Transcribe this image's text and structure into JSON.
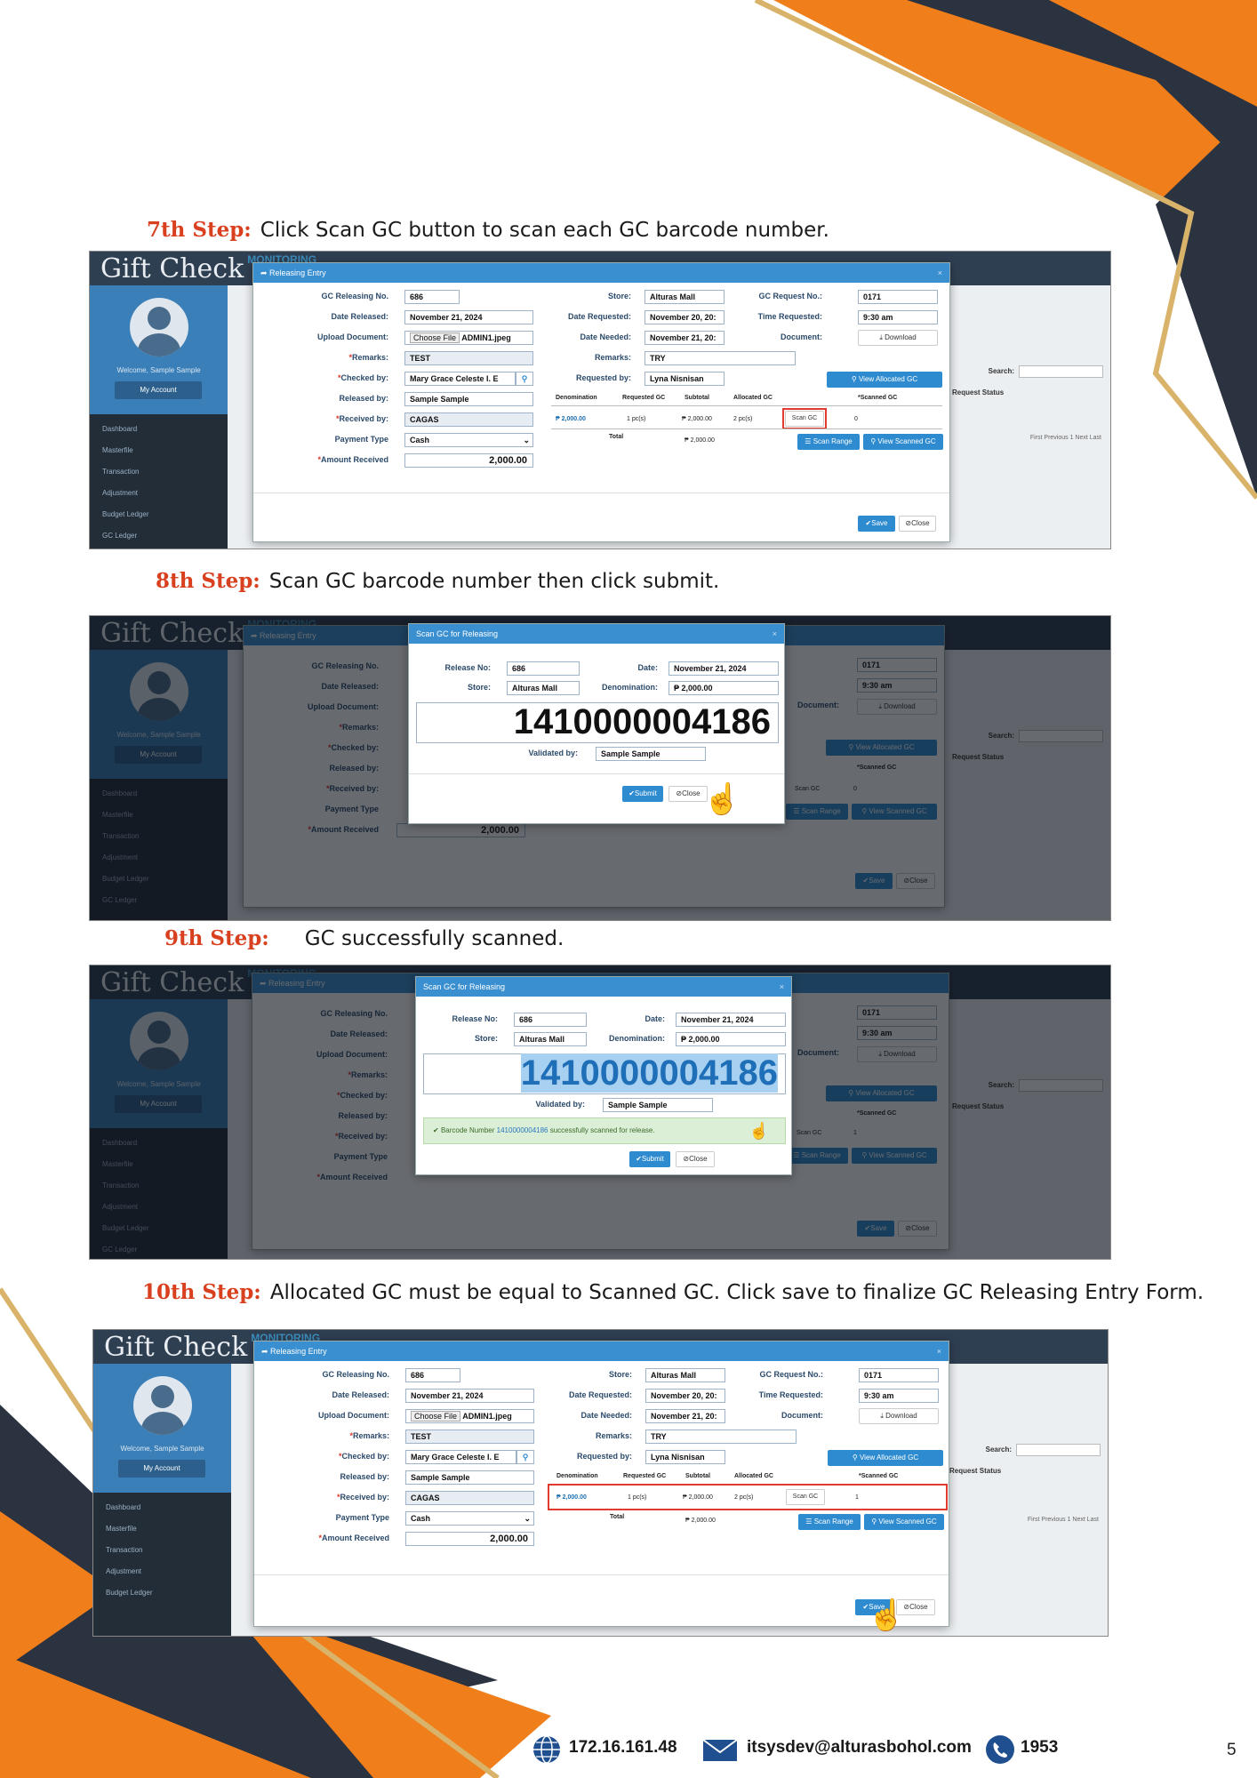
{
  "steps": {
    "s7": {
      "label": "7th Step:",
      "text": "Click Scan GC button to scan each GC barcode number."
    },
    "s8": {
      "label": "8th Step:",
      "text": "Scan GC barcode number then click submit."
    },
    "s9": {
      "label": "9th Step:",
      "text": "GC successfully scanned."
    },
    "s10": {
      "label": "10th Step:",
      "text": "Allocated GC must be equal to Scanned GC. Click save to finalize GC Releasing Entry Form."
    }
  },
  "app": {
    "brand": "Gift Check",
    "brand_sub": "MONITORING",
    "welcome": "Welcome, Sample Sample",
    "my_account": "My Account",
    "menu": [
      "Dashboard",
      "Masterfile",
      "Transaction",
      "Adjustment",
      "Budget Ledger",
      "GC Ledger"
    ],
    "search_label": "Search:",
    "request_status": "Request Status",
    "pager": "First   Previous   1   Next   Last"
  },
  "releasing": {
    "title": "Releasing Entry",
    "labels": {
      "gc_releasing_no": "GC Releasing No.",
      "date_released": "Date Released:",
      "upload_document": "Upload Document:",
      "remarks": "Remarks:",
      "checked_by": "Checked by:",
      "released_by": "Released by:",
      "received_by": "Received by:",
      "payment_type": "Payment Type",
      "amount_received": "Amount Received",
      "store": "Store:",
      "date_requested": "Date Requested:",
      "date_needed": "Date Needed:",
      "remarks2": "Remarks:",
      "requested_by": "Requested by:",
      "gc_request_no": "GC Request No.:",
      "time_requested": "Time Requested:",
      "document": "Document:"
    },
    "values": {
      "gc_releasing_no": "686",
      "date_released": "November 21, 2024",
      "choose_file": "Choose File",
      "file_name": "ADMIN1.jpeg",
      "remarks": "TEST",
      "checked_by": "Mary Grace Celeste I. E",
      "released_by": "Sample Sample",
      "received_by": "CAGAS",
      "payment_type": "Cash",
      "amount_received": "2,000.00",
      "store": "Alturas Mall",
      "date_requested": "November 20, 20:",
      "date_needed": "November 21, 20:",
      "remarks2": "TRY",
      "requested_by": "Lyna Nisnisan",
      "gc_request_no": "0171",
      "time_requested": "9:30 am",
      "download": "Download"
    },
    "table": {
      "headers": [
        "Denomination",
        "Requested GC",
        "Subtotal",
        "Allocated GC",
        "*Scanned GC"
      ],
      "row": {
        "denomination": "₱ 2,000.00",
        "requested": "1 pc(s)",
        "subtotal": "₱ 2,000.00",
        "allocated": "2 pc(s)",
        "scan_btn": "Scan GC"
      },
      "total_label": "Total",
      "total_value": "₱ 2,000.00",
      "scanned_before": "0",
      "scanned_after": "1"
    },
    "buttons": {
      "view_allocated": "View Allocated GC",
      "scan_range": "Scan Range",
      "view_scanned": "View Scanned GC",
      "save": "Save",
      "close": "Close"
    }
  },
  "scan_modal": {
    "title": "Scan GC for Releasing",
    "release_no_label": "Release No:",
    "release_no": "686",
    "date_label": "Date:",
    "date": "November 21, 2024",
    "store_label": "Store:",
    "store": "Alturas Mall",
    "denomination_label": "Denomination:",
    "denomination": "₱ 2,000.00",
    "barcode": "1410000004186",
    "validated_label": "Validated by:",
    "validated_by": "Sample Sample",
    "submit": "Submit",
    "close": "Close",
    "success_prefix": "Barcode Number",
    "success_number": "1410000004186",
    "success_suffix": "successfully scanned for release."
  },
  "footer": {
    "ip": "172.16.161.48",
    "email": "itsysdev@alturasbohol.com",
    "phone": "1953",
    "page": "5"
  },
  "colors": {
    "orange": "#f07f1b",
    "navy": "#2b3240",
    "gold": "#d9b36a",
    "step_red": "#d8401f",
    "accent_blue": "#3a8fd0"
  }
}
